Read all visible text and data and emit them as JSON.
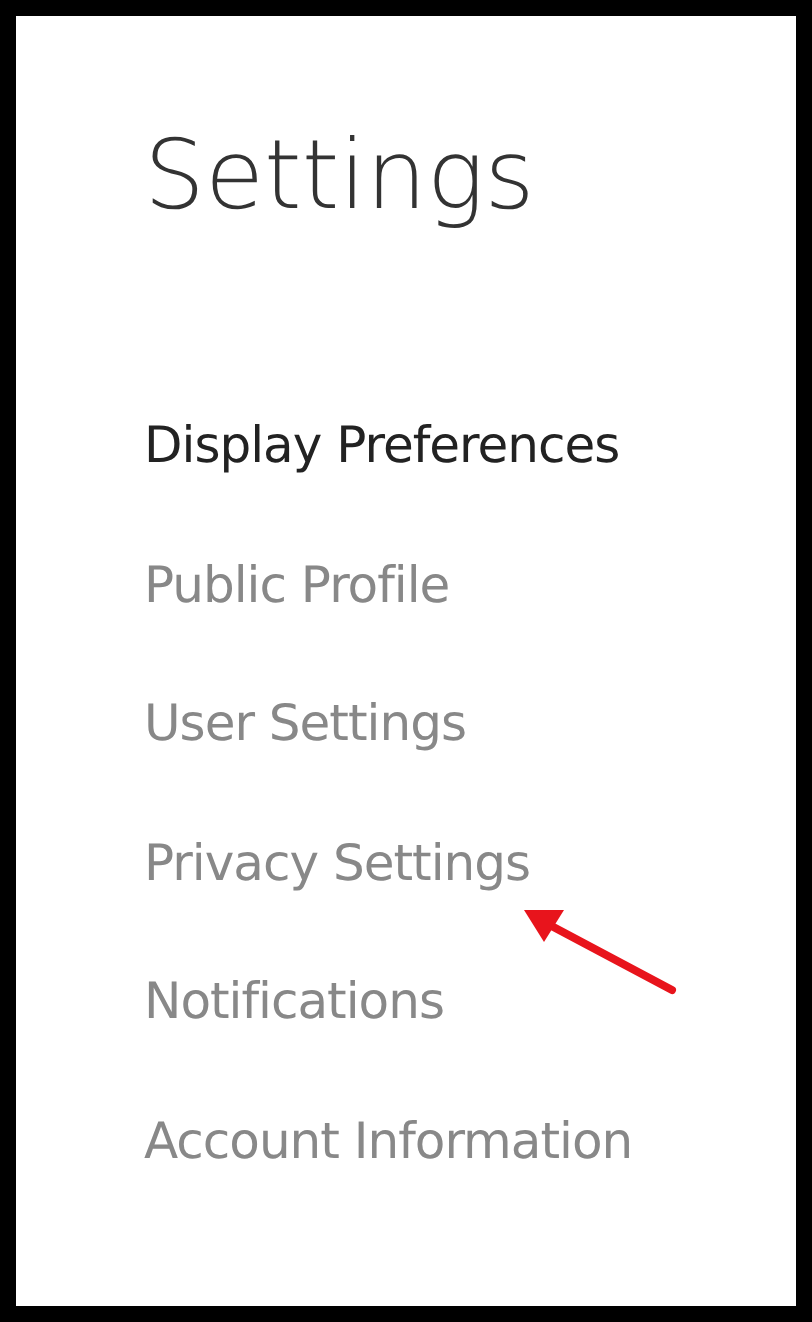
{
  "title": "Settings",
  "menu": [
    {
      "label": "Display Preferences",
      "selected": true
    },
    {
      "label": "Public Profile",
      "selected": false
    },
    {
      "label": "User Settings",
      "selected": false
    },
    {
      "label": "Privacy Settings",
      "selected": false
    },
    {
      "label": "Notifications",
      "selected": false
    },
    {
      "label": "Account Information",
      "selected": false
    }
  ]
}
